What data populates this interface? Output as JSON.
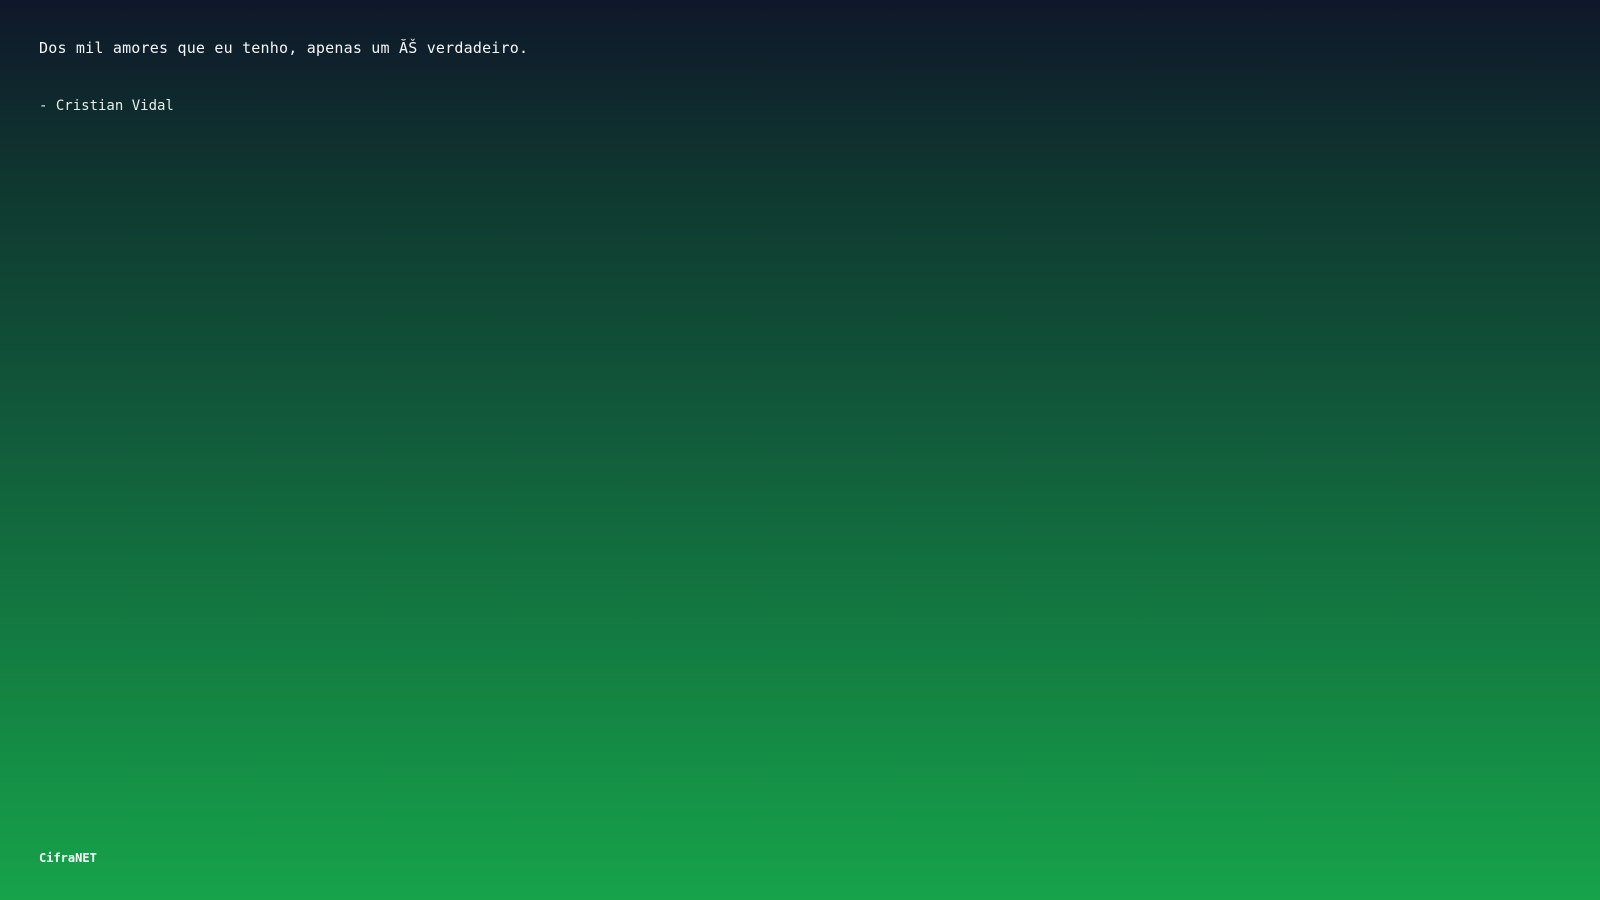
{
  "quote": {
    "text": "Dos mil amores que eu tenho, apenas um ĂŠ verdadeiro.",
    "author": "- Cristian Vidal"
  },
  "footer": {
    "brand": "CifraNET"
  }
}
